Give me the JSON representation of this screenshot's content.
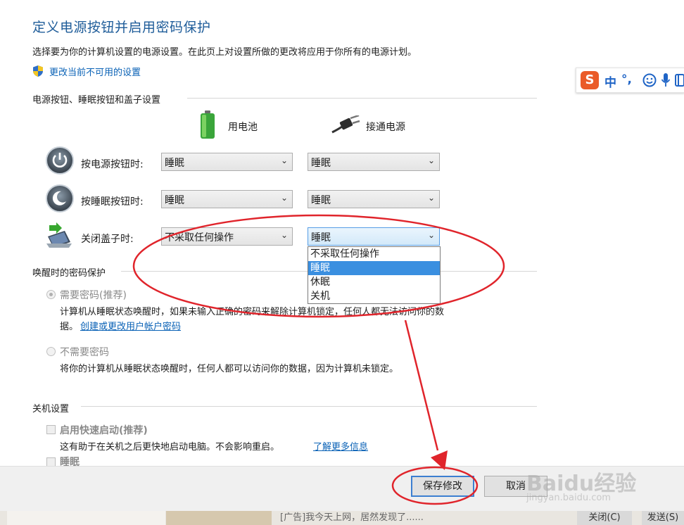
{
  "page": {
    "title": "定义电源按钮并启用密码保护",
    "description": "选择要为你的计算机设置的电源设置。在此页上对设置所做的更改将应用于你所有的电源计划。",
    "change_unavailable_link": "更改当前不可用的设置"
  },
  "power_buttons": {
    "section_label": "电源按钮、睡眠按钮和盖子设置",
    "col_battery": "用电池",
    "col_plugged": "接通电源",
    "rows": [
      {
        "label": "按电源按钮时:",
        "battery": "睡眠",
        "plugged": "睡眠"
      },
      {
        "label": "按睡眠按钮时:",
        "battery": "睡眠",
        "plugged": "睡眠"
      },
      {
        "label": "关闭盖子时:",
        "battery": "不采取任何操作",
        "plugged": "睡眠"
      }
    ],
    "dropdown_options": [
      "不采取任何操作",
      "睡眠",
      "休眠",
      "关机"
    ],
    "dropdown_selected": "睡眠"
  },
  "wake_password": {
    "section_label": "唤醒时的密码保护",
    "require_label": "需要密码(推荐)",
    "require_desc_1": "计算机从睡眠状态唤醒时，如果未输入正确的密码来解除计算机锁定，任何人都无法访问你的数",
    "require_desc_2": "据。",
    "create_password_link": "创建或更改用户帐户密码",
    "no_password_label": "不需要密码",
    "no_password_desc": "将你的计算机从睡眠状态唤醒时，任何人都可以访问你的数据，因为计算机未锁定。"
  },
  "shutdown": {
    "section_label": "关机设置",
    "fast_startup_label": "启用快速启动(推荐)",
    "fast_startup_desc": "这有助于在关机之后更快地启动电脑。不会影响重启。",
    "learn_more_link": "了解更多信息",
    "sleep_label": "睡眠"
  },
  "footer": {
    "save_label": "保存修改",
    "cancel_label": "取消"
  },
  "ime": {
    "logo": "S",
    "mode": "中",
    "punct": "°,"
  },
  "taskbar": {
    "ad_text": "[广告]我今天上网，居然发现了......",
    "close_label": "关闭(C)",
    "send_label": "发送(S)"
  },
  "watermark": {
    "brand": "Baidu经验",
    "url": "jingyan.baidu.com"
  },
  "colors": {
    "title_blue": "#1e5c99",
    "link_blue": "#0a62b6",
    "annotation_red": "#e0242b",
    "selection_blue": "#3a8fe0"
  },
  "icons": {
    "shield": "uac-shield-icon",
    "battery": "battery-icon",
    "plug": "power-plug-icon",
    "power_button": "power-button-icon",
    "sleep_button": "sleep-button-icon",
    "lid": "laptop-lid-icon",
    "dropdown": "chevron-down-icon"
  }
}
